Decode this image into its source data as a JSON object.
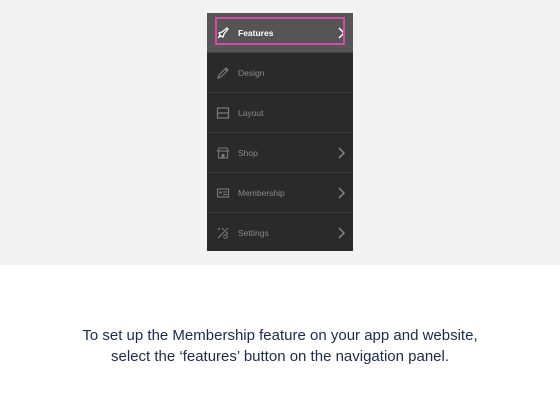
{
  "nav": {
    "items": [
      {
        "label": "Features",
        "icon": "rocket-icon",
        "has_chevron": true,
        "active": true
      },
      {
        "label": "Design",
        "icon": "pencil-icon",
        "has_chevron": false,
        "active": false
      },
      {
        "label": "Layout",
        "icon": "layout-icon",
        "has_chevron": false,
        "active": false
      },
      {
        "label": "Shop",
        "icon": "shop-icon",
        "has_chevron": true,
        "active": false
      },
      {
        "label": "Membership",
        "icon": "membership-card-icon",
        "has_chevron": true,
        "active": false
      },
      {
        "label": "Settings",
        "icon": "tools-icon",
        "has_chevron": true,
        "active": false
      }
    ],
    "highlight_color": "#d64aa6"
  },
  "caption": {
    "line1": "To set up the Membership feature on your app and website,",
    "line2": "select the ‘features’ button on the navigation panel."
  }
}
